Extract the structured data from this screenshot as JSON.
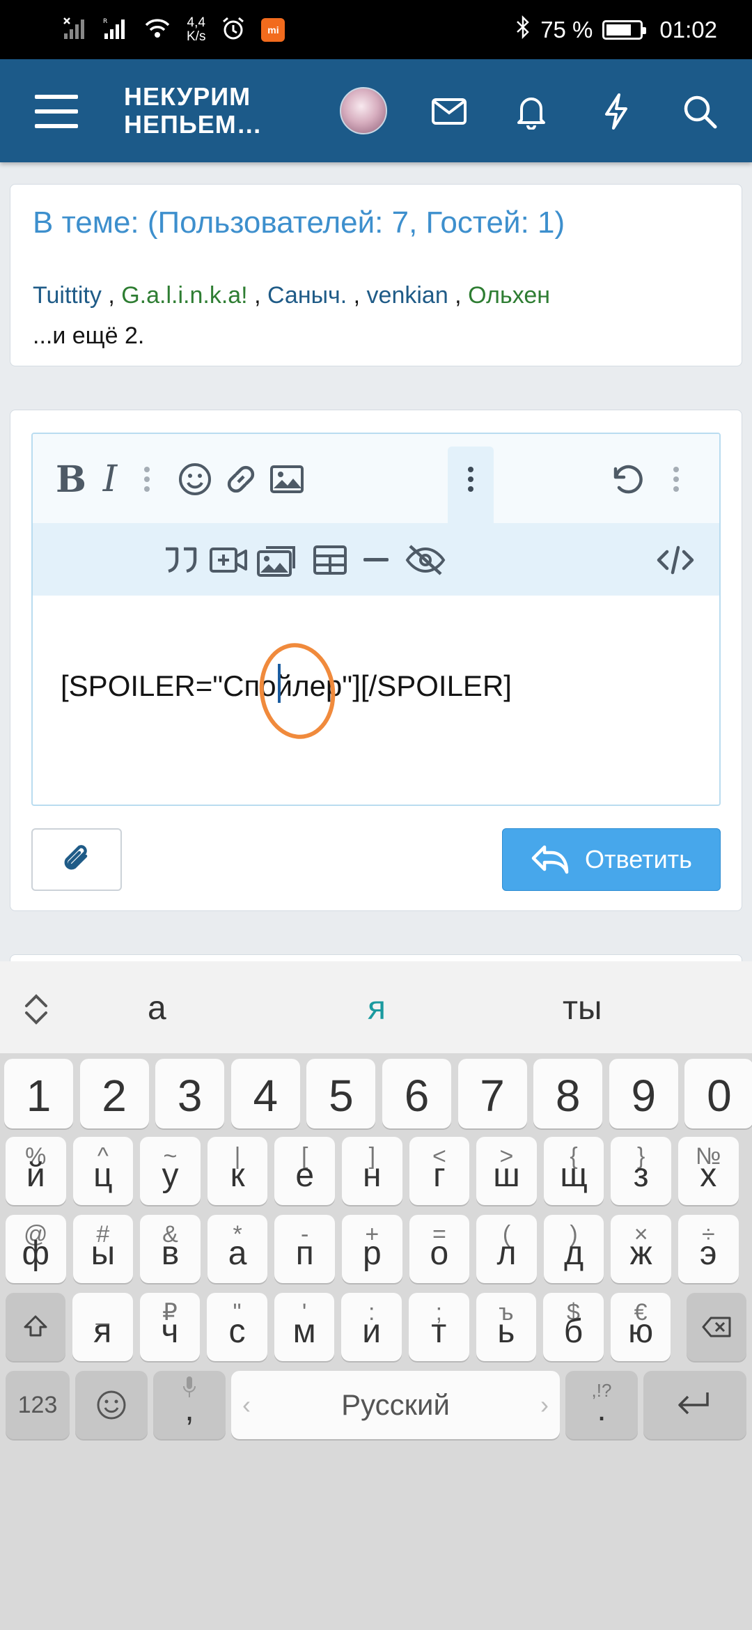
{
  "status_bar": {
    "net_speed": "4,4",
    "net_unit": "K/s",
    "mi_badge": "mi",
    "battery": "75 %",
    "battery_level": 0.75,
    "time": "01:02"
  },
  "header": {
    "site_title_line1": "НЕКУРИМ",
    "site_title_line2": "НЕПЬЕМ…",
    "icons": [
      "menu-icon",
      "avatar",
      "mail-icon",
      "bell-icon",
      "bolt-icon",
      "search-icon"
    ]
  },
  "viewers": {
    "title": "В теме: (Пользователей: 7, Гостей: 1)",
    "users": [
      "Tuittity",
      "G.a.l.i.n.k.a!",
      "Саныч.",
      "venkian",
      "Ольхен"
    ],
    "separator": " , ",
    "more": "...и ещё 2."
  },
  "editor": {
    "content": "[SPOILER=\"Спойлер\"][/SPOILER]",
    "toolbar_row1": [
      "bold",
      "italic",
      "more",
      "emoji",
      "link",
      "image",
      "more-active",
      "undo",
      "more"
    ],
    "toolbar_row2": [
      "quote",
      "media",
      "gallery",
      "table",
      "hr",
      "spoiler",
      "code"
    ],
    "bold_label": "B",
    "italic_label": "I"
  },
  "actions": {
    "reply_label": "Ответить"
  },
  "keyboard": {
    "suggestions": [
      "а",
      "я",
      "ты"
    ],
    "numbers": [
      "1",
      "2",
      "3",
      "4",
      "5",
      "6",
      "7",
      "8",
      "9",
      "0"
    ],
    "row1": [
      [
        "%",
        "й"
      ],
      [
        "^",
        "ц"
      ],
      [
        "~",
        "у"
      ],
      [
        "|",
        "к"
      ],
      [
        "[",
        "е"
      ],
      [
        "]",
        "н"
      ],
      [
        "<",
        "г"
      ],
      [
        ">",
        "ш"
      ],
      [
        "{",
        "щ"
      ],
      [
        "}",
        "з"
      ],
      [
        "№",
        "х"
      ]
    ],
    "row2": [
      [
        "@",
        "ф"
      ],
      [
        "#",
        "ы"
      ],
      [
        "&",
        "в"
      ],
      [
        "*",
        "а"
      ],
      [
        "-",
        "п"
      ],
      [
        "+",
        "р"
      ],
      [
        "=",
        "о"
      ],
      [
        "(",
        "л"
      ],
      [
        ")",
        "д"
      ],
      [
        "×",
        "ж"
      ],
      [
        "÷",
        "э"
      ]
    ],
    "row3": [
      [
        "_",
        "я"
      ],
      [
        "₽",
        "ч"
      ],
      [
        "\"",
        "с"
      ],
      [
        "'",
        "м"
      ],
      [
        ":",
        "и"
      ],
      [
        ";",
        "т"
      ],
      [
        "ъ",
        "ь"
      ],
      [
        "$",
        "б"
      ],
      [
        "€",
        "ю"
      ]
    ],
    "sym_label": "123",
    "comma": ",",
    "space_label": "Русский",
    "period": ".",
    "period_sec": ",!?"
  },
  "colors": {
    "header": "#1c5a89",
    "link_blue": "#3d8fcd",
    "user_green": "#2e7d32",
    "reply_button": "#47a7eb",
    "highlight_circle": "#f08a3c"
  }
}
